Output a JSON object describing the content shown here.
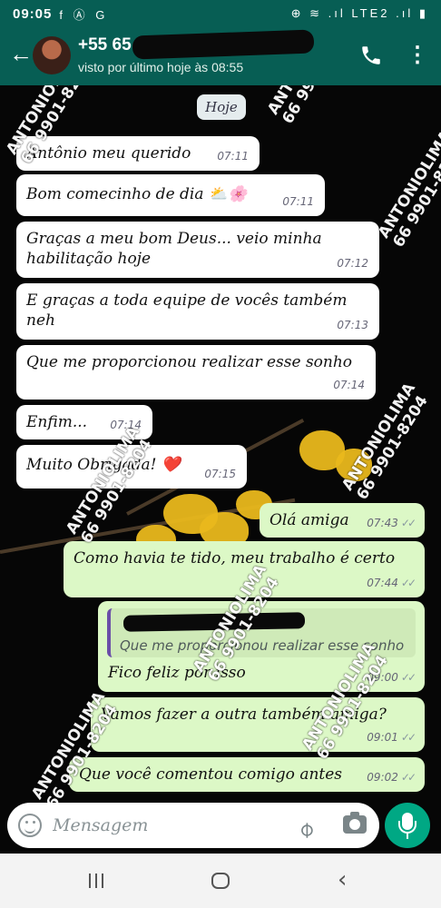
{
  "status_bar": {
    "time": "09:05",
    "left_icons": "f Ⓐ G",
    "right_icons": "⊕ ≋ .ıl LTE2 .ıl ▮",
    "network": "Vo)) LTE2"
  },
  "header": {
    "contact_name": "+55 65",
    "contact_status": "visto por último hoje às 08:55",
    "back_icon": "arrow-left",
    "call_icon": "phone",
    "menu_icon": "more-vert"
  },
  "chat": {
    "date_chip": "Hoje",
    "messages": [
      {
        "dir": "in",
        "text": "Antônio meu querido",
        "time": "07:11"
      },
      {
        "dir": "in",
        "text": "Bom comecinho de dia",
        "emoji": "⛅🌸",
        "time": "07:11"
      },
      {
        "dir": "in",
        "text": "Graças a meu bom Deus... veio minha",
        "text2": "habilitação hoje",
        "time": "07:12"
      },
      {
        "dir": "in",
        "text": "E graças a toda equipe de vocês também",
        "text2": "neh",
        "time": "07:13"
      },
      {
        "dir": "in",
        "text": "Que me proporcionou realizar esse sonho",
        "time": "07:14"
      },
      {
        "dir": "in",
        "text": "Enfim...",
        "time": "07:14"
      },
      {
        "dir": "in",
        "text": "Muito Obrigada!",
        "emoji": "❤️",
        "time": "07:15"
      },
      {
        "dir": "out",
        "text": "Olá amiga",
        "time": "07:43",
        "ticks": "✓✓"
      },
      {
        "dir": "out",
        "text": "Como havia te tido, meu trabalho é certo",
        "time": "07:44",
        "ticks": "✓✓"
      },
      {
        "dir": "out",
        "quote": "Que me proporcionou realizar esse sonho",
        "text": "Fico feliz por isso",
        "time": "09:00",
        "ticks": "✓✓"
      },
      {
        "dir": "out",
        "text": "Vamos fazer a outra também amiga?",
        "time": "09:01",
        "ticks": "✓✓"
      },
      {
        "dir": "out",
        "text": "Que você comentou comigo antes",
        "time": "09:02",
        "ticks": "✓✓"
      }
    ]
  },
  "watermark": {
    "line1": "ANTONIOLIMA",
    "line2": "66 9901-8204"
  },
  "input": {
    "placeholder": "Mensagem",
    "emoji_icon": "emoji",
    "attach_icon": "paperclip",
    "camera_icon": "camera",
    "mic_icon": "mic"
  },
  "colors": {
    "header": "#075e54",
    "incoming": "#ffffff",
    "outgoing": "#dcf8c6",
    "mic_button": "#00a884"
  }
}
